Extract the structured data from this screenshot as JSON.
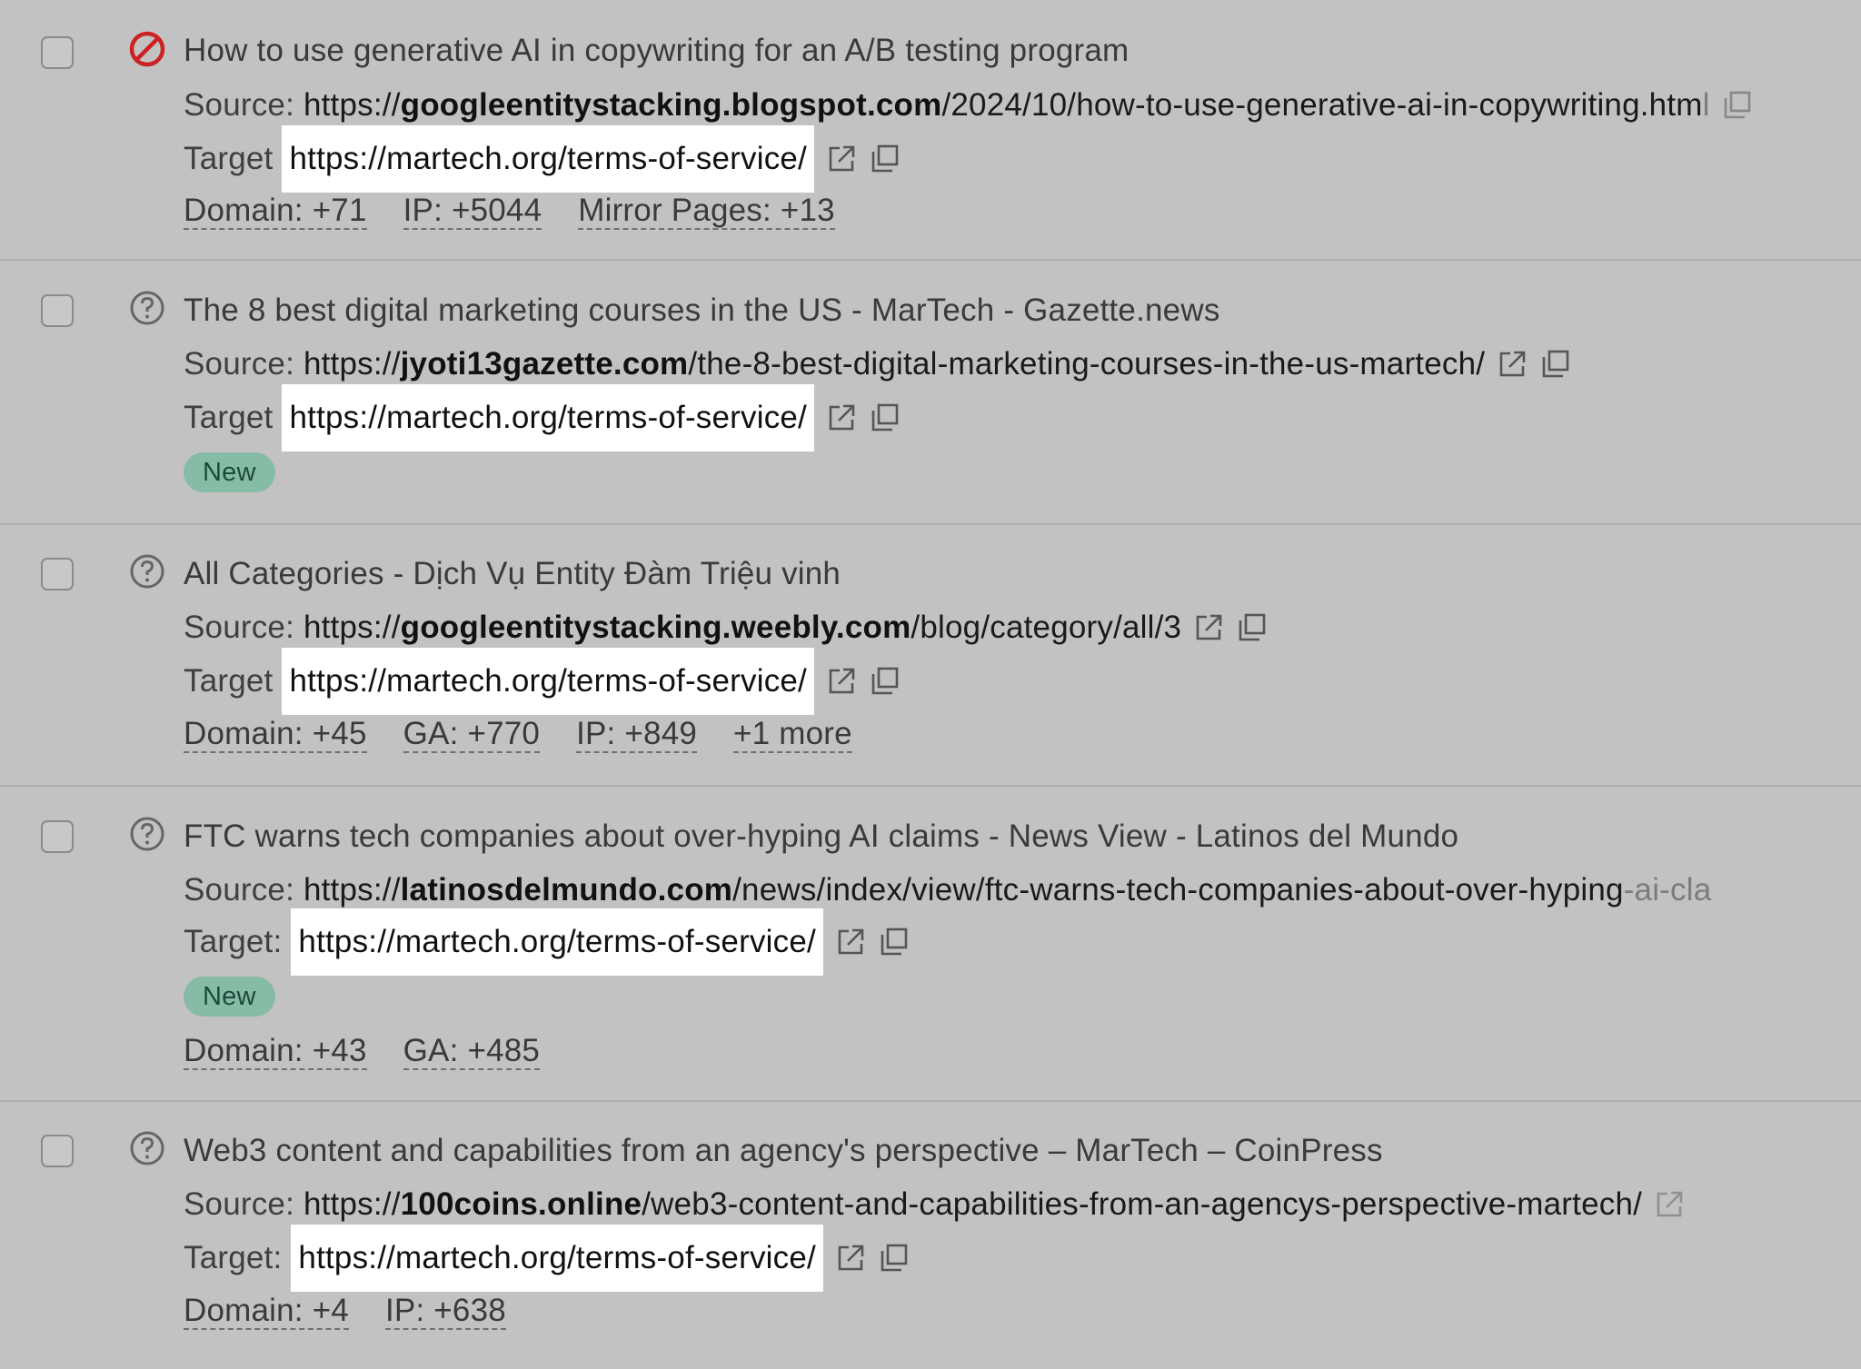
{
  "labels": {
    "source": "Source:",
    "target": "Target",
    "target_colon": "Target:"
  },
  "rows": [
    {
      "status": "blocked",
      "title": "How to use generative AI in copywriting for an A/B testing program",
      "source_prefix": "https://",
      "source_domain": "googleentitystacking.blogspot.com",
      "source_path": "/2024/10/how-to-use-generative-ai-in-copywriting.htm",
      "source_fade": "l",
      "target": "https://martech.org/terms-of-service/",
      "metrics": [
        "Domain: +71",
        "IP: +5044",
        "Mirror Pages: +13"
      ]
    },
    {
      "status": "unknown",
      "title": "The 8 best digital marketing courses in the US - MarTech - Gazette.news",
      "source_prefix": "https://",
      "source_domain": "jyoti13gazette.com",
      "source_path": "/the-8-best-digital-marketing-courses-in-the-us-martech/",
      "target": "https://martech.org/terms-of-service/",
      "badge": "New"
    },
    {
      "status": "unknown",
      "title": "All Categories - Dịch Vụ Entity Đàm Triệu vinh",
      "source_prefix": "https://",
      "source_domain": "googleentitystacking.weebly.com",
      "source_path": "/blog/category/all/3",
      "target": "https://martech.org/terms-of-service/",
      "metrics": [
        "Domain: +45",
        "GA: +770",
        "IP: +849",
        "+1 more"
      ]
    },
    {
      "status": "unknown",
      "title": "FTC warns tech companies about over-hyping AI claims - News View - Latinos del Mundo",
      "source_prefix": "https://",
      "source_domain": "latinosdelmundo.com",
      "source_path": "/news/index/view/ftc-warns-tech-companies-about-over-hyping",
      "source_fade": "-ai-cla",
      "target": "https://martech.org/terms-of-service/",
      "badge": "New",
      "metrics": [
        "Domain: +43",
        "GA: +485"
      ]
    },
    {
      "status": "unknown",
      "title": "Web3 content and capabilities from an agency's perspective – MarTech – CoinPress",
      "source_prefix": "https://",
      "source_domain": "100coins.online",
      "source_path": "/web3-content-and-capabilities-from-an-agencys-perspective-martech/",
      "target": "https://martech.org/terms-of-service/",
      "metrics": [
        "Domain: +4",
        "IP: +638"
      ]
    }
  ]
}
